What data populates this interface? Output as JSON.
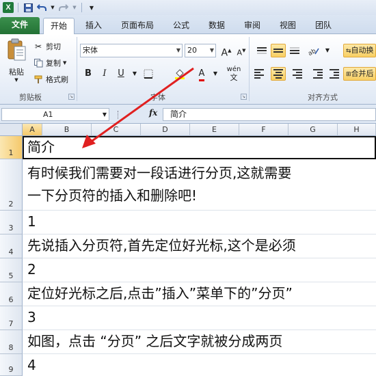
{
  "app": {
    "logo": "X"
  },
  "quick_access": {
    "save_icon": "save-icon",
    "undo_icon": "undo-icon",
    "redo_icon": "redo-icon"
  },
  "tabs": [
    {
      "label": "文件"
    },
    {
      "label": "开始"
    },
    {
      "label": "插入"
    },
    {
      "label": "页面布局"
    },
    {
      "label": "公式"
    },
    {
      "label": "数据"
    },
    {
      "label": "审阅"
    },
    {
      "label": "视图"
    },
    {
      "label": "团队"
    }
  ],
  "ribbon": {
    "clipboard": {
      "paste": "粘贴",
      "cut": "剪切",
      "copy": "复制",
      "format_painter": "格式刷",
      "group_label": "剪贴板"
    },
    "font": {
      "family": "宋体",
      "size": "20",
      "bold": "B",
      "italic": "I",
      "underline": "U",
      "font_color_letter": "A",
      "phonetic": "wén",
      "group_label": "字体"
    },
    "alignment": {
      "wrap_text": "自动换",
      "merge": "合并后",
      "group_label": "对齐方式"
    }
  },
  "formula_bar": {
    "name_box": "A1",
    "fx": "fx",
    "content": "简介"
  },
  "columns": [
    "A",
    "B",
    "C",
    "D",
    "E",
    "F",
    "G",
    "H"
  ],
  "rows": [
    {
      "num": "1",
      "lines": [
        "简介"
      ]
    },
    {
      "num": "2",
      "lines": [
        "有时候我们需要对一段话进行分页,这就需要",
        "一下分页符的插入和删除吧!"
      ]
    },
    {
      "num": "3",
      "lines": [
        "1"
      ]
    },
    {
      "num": "4",
      "lines": [
        "先说插入分页符,首先定位好光标,这个是必须"
      ]
    },
    {
      "num": "5",
      "lines": [
        "2"
      ]
    },
    {
      "num": "6",
      "lines": [
        "定位好光标之后,点击”插入”菜单下的”分页”"
      ]
    },
    {
      "num": "7",
      "lines": [
        "3"
      ]
    },
    {
      "num": "8",
      "lines": [
        "如图，点击 “分页” 之后文字就被分成两页"
      ]
    },
    {
      "num": "9",
      "lines": [
        "4"
      ]
    }
  ],
  "annotation": {
    "color": "#e02020"
  }
}
